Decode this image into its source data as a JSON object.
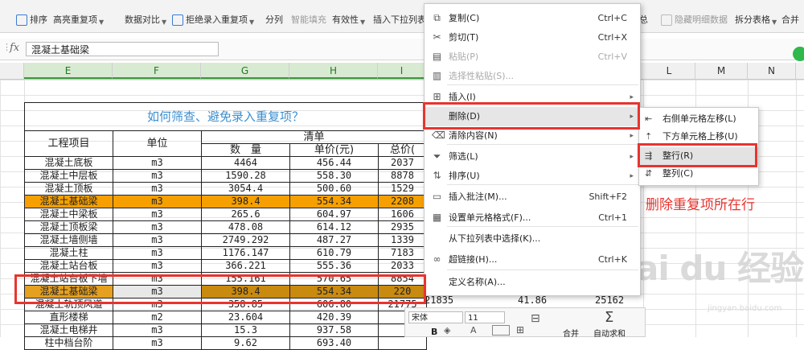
{
  "ribbon": {
    "items": [
      {
        "name": "sort",
        "label": "排序"
      },
      {
        "name": "highlight-dup",
        "label": "高亮重复项"
      },
      {
        "name": "data-compare",
        "label": "数据对比"
      },
      {
        "name": "reject-dup",
        "label": "拒绝录入重复项"
      },
      {
        "name": "split",
        "label": "分列"
      },
      {
        "name": "smart-fill",
        "label": "智能填充"
      },
      {
        "name": "validity",
        "label": "有效性"
      },
      {
        "name": "insert-dropdown",
        "label": "插入下拉列表"
      },
      {
        "name": "subtotal",
        "label": "总"
      },
      {
        "name": "hide-detail",
        "label": "隐藏明细数据"
      },
      {
        "name": "split-table",
        "label": "拆分表格"
      },
      {
        "name": "merge",
        "label": "合并"
      }
    ]
  },
  "formula_bar": {
    "fx": "fx",
    "cell_value": "混凝土基础梁"
  },
  "columns": [
    "E",
    "F",
    "G",
    "H",
    "I",
    "L",
    "M",
    "N"
  ],
  "table": {
    "title": "如何筛查、避免录入重复项？",
    "headers": {
      "project": "工程项目",
      "unit": "单位",
      "list": "清单",
      "qty": "数　量",
      "price": "单价(元)",
      "total": "总价("
    },
    "rows": [
      {
        "project": "混凝土底板",
        "unit": "m3",
        "qty": "4464",
        "price": "456.44",
        "total": "2037"
      },
      {
        "project": "混凝土中层板",
        "unit": "m3",
        "qty": "1590.28",
        "price": "558.30",
        "total": "8878"
      },
      {
        "project": "混凝土顶板",
        "unit": "m3",
        "qty": "3054.4",
        "price": "500.60",
        "total": "1529"
      },
      {
        "project": "混凝土基础梁",
        "unit": "m3",
        "qty": "398.4",
        "price": "554.34",
        "total": "2208"
      },
      {
        "project": "混凝土中梁板",
        "unit": "m3",
        "qty": "265.6",
        "price": "604.97",
        "total": "1606"
      },
      {
        "project": "混凝土顶板梁",
        "unit": "m3",
        "qty": "478.08",
        "price": "614.12",
        "total": "2935"
      },
      {
        "project": "混凝土墙侧墙",
        "unit": "m3",
        "qty": "2749.292",
        "price": "487.27",
        "total": "1339"
      },
      {
        "project": "混凝土柱",
        "unit": "m3",
        "qty": "1176.147",
        "price": "610.79",
        "total": "7183"
      },
      {
        "project": "混凝土站台板",
        "unit": "m3",
        "qty": "366.221",
        "price": "555.36",
        "total": "2033"
      },
      {
        "project": "混凝土站台板下墙",
        "unit": "m3",
        "qty": "155.161",
        "price": "570.65",
        "total": "8854"
      },
      {
        "project": "混凝土基础梁",
        "unit": "m3",
        "qty": "398.4",
        "price": "554.34",
        "total": "220"
      },
      {
        "project": "混凝土轨顶风道",
        "unit": "m3",
        "qty": "358.85",
        "price": "606.80",
        "total": "21775"
      },
      {
        "project": "直形楼梯",
        "unit": "m2",
        "qty": "23.604",
        "price": "420.39",
        "total": ""
      },
      {
        "project": "混凝土电梯井",
        "unit": "m3",
        "qty": "15.3",
        "price": "937.58",
        "total": ""
      },
      {
        "project": "柱中档台阶",
        "unit": "m3",
        "qty": "9.62",
        "price": "693.40",
        "total": ""
      }
    ]
  },
  "context_menu": {
    "items": [
      {
        "icon": "copy-icon",
        "glyph": "⧉",
        "label": "复制(C)",
        "shortcut": "Ctrl+C",
        "disabled": false,
        "arrow": false
      },
      {
        "icon": "cut-icon",
        "glyph": "✂",
        "label": "剪切(T)",
        "shortcut": "Ctrl+X",
        "disabled": false,
        "arrow": false
      },
      {
        "icon": "paste-icon",
        "glyph": "▤",
        "label": "粘贴(P)",
        "shortcut": "Ctrl+V",
        "disabled": true,
        "arrow": false
      },
      {
        "icon": "paste-special-icon",
        "glyph": "▥",
        "label": "选择性粘贴(S)...",
        "shortcut": "",
        "disabled": true,
        "arrow": false
      },
      {
        "icon": "insert-icon",
        "glyph": "⊞",
        "label": "插入(I)",
        "shortcut": "",
        "disabled": false,
        "arrow": true
      },
      {
        "icon": "",
        "glyph": "",
        "label": "删除(D)",
        "shortcut": "",
        "disabled": false,
        "arrow": true,
        "highlight": true
      },
      {
        "icon": "clear-icon",
        "glyph": "⌫",
        "label": "清除内容(N)",
        "shortcut": "",
        "disabled": false,
        "arrow": true
      },
      {
        "icon": "filter-icon",
        "glyph": "⏷",
        "label": "筛选(L)",
        "shortcut": "",
        "disabled": false,
        "arrow": true
      },
      {
        "icon": "sort-icon",
        "glyph": "⇅",
        "label": "排序(U)",
        "shortcut": "",
        "disabled": false,
        "arrow": true
      },
      {
        "icon": "comment-icon",
        "glyph": "▭",
        "label": "插入批注(M)...",
        "shortcut": "Shift+F2",
        "disabled": false,
        "arrow": false
      },
      {
        "icon": "format-cells-icon",
        "glyph": "▦",
        "label": "设置单元格格式(F)...",
        "shortcut": "Ctrl+1",
        "disabled": false,
        "arrow": false
      },
      {
        "icon": "",
        "glyph": "",
        "label": "从下拉列表中选择(K)...",
        "shortcut": "",
        "disabled": false,
        "arrow": false
      },
      {
        "icon": "link-icon",
        "glyph": "∞",
        "label": "超链接(H)...",
        "shortcut": "Ctrl+K",
        "disabled": false,
        "arrow": false
      },
      {
        "icon": "",
        "glyph": "",
        "label": "定义名称(A)...",
        "shortcut": "",
        "disabled": false,
        "arrow": false
      }
    ]
  },
  "delete_submenu": {
    "items": [
      {
        "icon": "shift-left-icon",
        "glyph": "⇤",
        "label": "右侧单元格左移(L)"
      },
      {
        "icon": "shift-up-icon",
        "glyph": "⇡",
        "label": "下方单元格上移(U)"
      },
      {
        "icon": "delete-row-icon",
        "glyph": "⇶",
        "label": "整行(R)",
        "highlight": true
      },
      {
        "icon": "delete-column-icon",
        "glyph": "⇵",
        "label": "整列(C)"
      }
    ]
  },
  "annotation": "删除重复项所在行",
  "partial_row": {
    "c1": "21835",
    "c2": "41.86",
    "c3": "25162"
  },
  "mini_toolbar": {
    "font": "宋体",
    "size": "11",
    "merge": "合并",
    "autosum": "自动求和",
    "bold": "B"
  },
  "watermark": {
    "brand": "Bai du 经验",
    "url": "jingyan.baidu.com"
  }
}
